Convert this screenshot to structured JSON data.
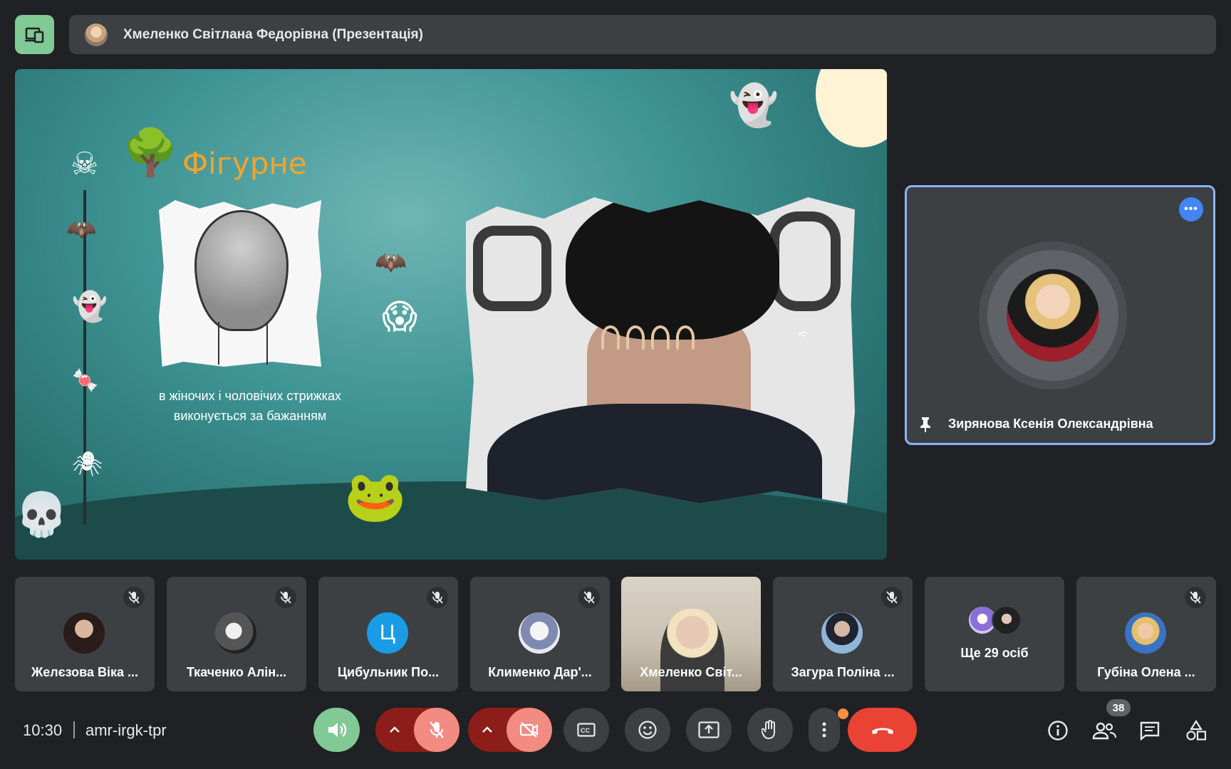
{
  "header": {
    "presenter_name": "Хмеленко Світлана Федорівна (Презентація)"
  },
  "slide": {
    "title": "Фігурне",
    "caption_line1": "в жіночих і чоловічих стрижках",
    "caption_line2": "виконується за бажанням"
  },
  "pinned": {
    "name": "Зирянова Ксенія Олександрівна",
    "more_label": "•••"
  },
  "participants": [
    {
      "name": "Желєзова Віка ...",
      "muted": true
    },
    {
      "name": "Ткаченко Алін...",
      "muted": true
    },
    {
      "name": "Цибульник По...",
      "muted": true,
      "initial": "Ц"
    },
    {
      "name": "Клименко Дар'...",
      "muted": true
    },
    {
      "name": "Хмеленко Світ...",
      "muted": false
    },
    {
      "name": "Загура Поліна ...",
      "muted": true
    },
    {
      "name": "Ще 29 осіб"
    },
    {
      "name": "Губіна Олена ...",
      "muted": true
    }
  ],
  "bottom_bar": {
    "time": "10:30",
    "meeting_code": "amr-irgk-tpr",
    "people_count": "38"
  },
  "colors": {
    "accent_green": "#81c995",
    "muted_red": "#f28b82",
    "hangup_red": "#ea4335",
    "pin_border": "#8ab4f8"
  }
}
